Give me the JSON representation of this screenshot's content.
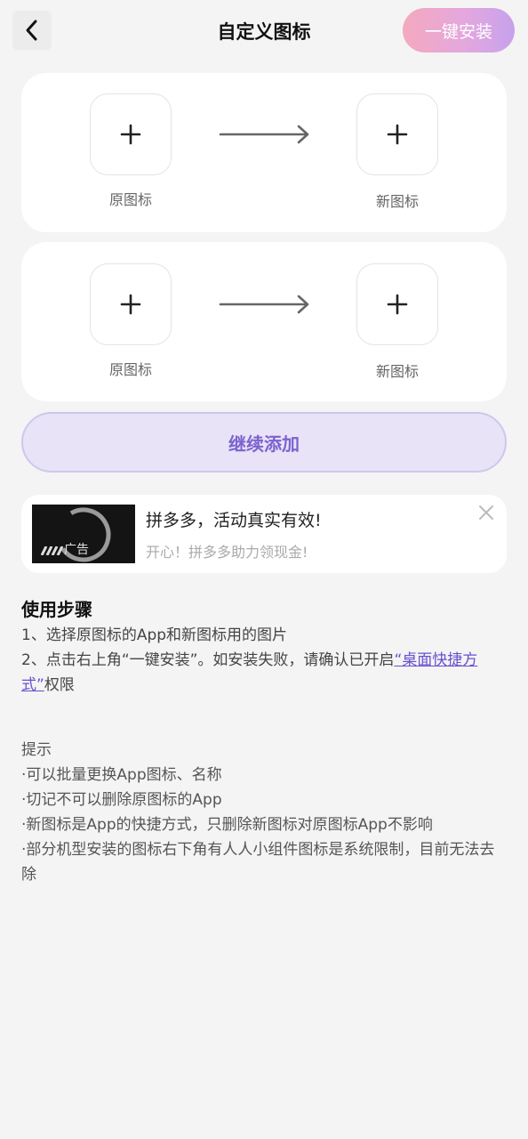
{
  "header": {
    "title": "自定义图标",
    "install_label": "一键安装"
  },
  "cards": [
    {
      "original_label": "原图标",
      "new_label": "新图标"
    },
    {
      "original_label": "原图标",
      "new_label": "新图标"
    }
  ],
  "continue_label": "继续添加",
  "ad": {
    "tag": "广告",
    "title": "拼多多，活动真实有效!",
    "subtitle": "开心！拼多多助力领现金!"
  },
  "steps": {
    "title": "使用步骤",
    "step1": "1、选择原图标的App和新图标用的图片",
    "step2_prefix": "2、点击右上角“一键安装”。如安装失败，请确认已开启",
    "step2_link": "“桌面快捷方式”",
    "step2_suffix": "权限"
  },
  "tips": {
    "title": "提示",
    "items": [
      "·可以批量更换App图标、名称",
      "·切记不可以删除原图标的App",
      "·新图标是App的快捷方式，只删除新图标对原图标App不影响",
      "·部分机型安装的图标右下角有人人小组件图标是系统限制，目前无法去除"
    ]
  }
}
